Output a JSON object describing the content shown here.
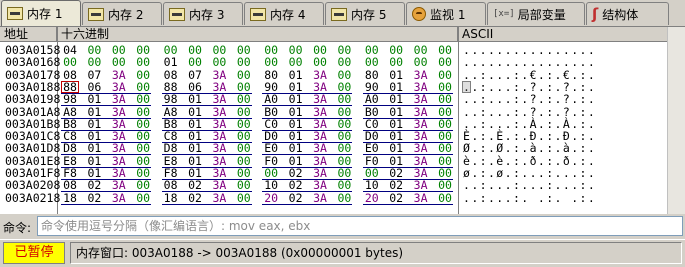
{
  "tabs": [
    {
      "label": "内存 1",
      "icon": "memory-icon",
      "active": true
    },
    {
      "label": "内存 2",
      "icon": "memory-icon",
      "active": false
    },
    {
      "label": "内存 3",
      "icon": "memory-icon",
      "active": false
    },
    {
      "label": "内存 4",
      "icon": "memory-icon",
      "active": false
    },
    {
      "label": "内存 5",
      "icon": "memory-icon",
      "active": false
    },
    {
      "label": "监视 1",
      "icon": "watch-icon",
      "active": false
    },
    {
      "label": "局部变量",
      "icon": "local-vars-icon",
      "icon_text": "[x=]",
      "active": false
    },
    {
      "label": "结构体",
      "icon": "struct-icon",
      "icon_text": "ʃ",
      "active": false
    }
  ],
  "columns": {
    "address": "地址",
    "hex": "十六进制",
    "ascii": "ASCII"
  },
  "colors": {
    "green": "#008000",
    "red": "#c00000",
    "purple": "#800080",
    "black": "#000000",
    "underline": "#000080"
  },
  "rows": [
    {
      "address": "003A0158",
      "bytes": [
        "04",
        "00",
        "00",
        "00",
        "00",
        "00",
        "00",
        "00",
        "00",
        "00",
        "00",
        "00",
        "00",
        "00",
        "00",
        "00"
      ],
      "colors": [
        "k",
        "g",
        "g",
        "g",
        "g",
        "g",
        "g",
        "g",
        "g",
        "g",
        "g",
        "g",
        "g",
        "g",
        "g",
        "g"
      ],
      "ascii": "................"
    },
    {
      "address": "003A0168",
      "bytes": [
        "00",
        "00",
        "00",
        "00",
        "01",
        "00",
        "00",
        "00",
        "00",
        "00",
        "00",
        "00",
        "00",
        "00",
        "00",
        "00"
      ],
      "colors": [
        "g",
        "g",
        "g",
        "g",
        "k",
        "g",
        "g",
        "g",
        "g",
        "g",
        "g",
        "g",
        "g",
        "g",
        "g",
        "g"
      ],
      "ascii": "................"
    },
    {
      "address": "003A0178",
      "bytes": [
        "08",
        "07",
        "3A",
        "00",
        "08",
        "07",
        "3A",
        "00",
        "80",
        "01",
        "3A",
        "00",
        "80",
        "01",
        "3A",
        "00"
      ],
      "colors": [
        "k",
        "k",
        "p",
        "g",
        "k",
        "k",
        "p",
        "g",
        "k",
        "k",
        "p",
        "g",
        "k",
        "k",
        "p",
        "g"
      ],
      "ascii": "..:...:.€.:.€.:."
    },
    {
      "address": "003A0188",
      "bytes": [
        "88",
        "06",
        "3A",
        "00",
        "88",
        "06",
        "3A",
        "00",
        "90",
        "01",
        "3A",
        "00",
        "90",
        "01",
        "3A",
        "00"
      ],
      "colors": [
        "k",
        "k",
        "p",
        "g",
        "k",
        "k",
        "p",
        "g",
        "k",
        "k",
        "p",
        "g",
        "k",
        "k",
        "p",
        "g"
      ],
      "ascii": "..:...:.?.:.?.:."
    },
    {
      "address": "003A0198",
      "bytes": [
        "98",
        "01",
        "3A",
        "00",
        "98",
        "01",
        "3A",
        "00",
        "A0",
        "01",
        "3A",
        "00",
        "A0",
        "01",
        "3A",
        "00"
      ],
      "colors": [
        "k",
        "k",
        "p",
        "g",
        "k",
        "k",
        "p",
        "g",
        "k",
        "k",
        "p",
        "g",
        "k",
        "k",
        "p",
        "g"
      ],
      "ascii": "..:...:.?.:.?.:."
    },
    {
      "address": "003A01A8",
      "bytes": [
        "A8",
        "01",
        "3A",
        "00",
        "A8",
        "01",
        "3A",
        "00",
        "B0",
        "01",
        "3A",
        "00",
        "B0",
        "01",
        "3A",
        "00"
      ],
      "colors": [
        "k",
        "k",
        "p",
        "g",
        "k",
        "k",
        "p",
        "g",
        "k",
        "k",
        "p",
        "g",
        "k",
        "k",
        "p",
        "g"
      ],
      "ascii": "..:...:.?.:.?.:."
    },
    {
      "address": "003A01B8",
      "bytes": [
        "B8",
        "01",
        "3A",
        "00",
        "B8",
        "01",
        "3A",
        "00",
        "C0",
        "01",
        "3A",
        "00",
        "C0",
        "01",
        "3A",
        "00"
      ],
      "colors": [
        "k",
        "k",
        "p",
        "g",
        "k",
        "k",
        "p",
        "g",
        "k",
        "k",
        "p",
        "g",
        "k",
        "k",
        "p",
        "g"
      ],
      "ascii": "..:...:.À.:.À.:."
    },
    {
      "address": "003A01C8",
      "bytes": [
        "C8",
        "01",
        "3A",
        "00",
        "C8",
        "01",
        "3A",
        "00",
        "D0",
        "01",
        "3A",
        "00",
        "D0",
        "01",
        "3A",
        "00"
      ],
      "colors": [
        "k",
        "k",
        "p",
        "g",
        "k",
        "k",
        "p",
        "g",
        "k",
        "k",
        "p",
        "g",
        "k",
        "k",
        "p",
        "g"
      ],
      "ascii": "È.:.È.:.Ð.:.Ð.:."
    },
    {
      "address": "003A01D8",
      "bytes": [
        "D8",
        "01",
        "3A",
        "00",
        "D8",
        "01",
        "3A",
        "00",
        "E0",
        "01",
        "3A",
        "00",
        "E0",
        "01",
        "3A",
        "00"
      ],
      "colors": [
        "k",
        "k",
        "p",
        "g",
        "k",
        "k",
        "p",
        "g",
        "k",
        "k",
        "p",
        "g",
        "k",
        "k",
        "p",
        "g"
      ],
      "ascii": "Ø.:.Ø.:.à.:.à.:."
    },
    {
      "address": "003A01E8",
      "bytes": [
        "E8",
        "01",
        "3A",
        "00",
        "E8",
        "01",
        "3A",
        "00",
        "F0",
        "01",
        "3A",
        "00",
        "F0",
        "01",
        "3A",
        "00"
      ],
      "colors": [
        "k",
        "k",
        "p",
        "g",
        "k",
        "k",
        "p",
        "g",
        "k",
        "k",
        "p",
        "g",
        "k",
        "k",
        "p",
        "g"
      ],
      "ascii": "è.:.è.:.ð.:.ð.:."
    },
    {
      "address": "003A01F8",
      "bytes": [
        "F8",
        "01",
        "3A",
        "00",
        "F8",
        "01",
        "3A",
        "00",
        "00",
        "02",
        "3A",
        "00",
        "00",
        "02",
        "3A",
        "00"
      ],
      "colors": [
        "k",
        "k",
        "p",
        "g",
        "k",
        "k",
        "p",
        "g",
        "g",
        "k",
        "p",
        "g",
        "g",
        "k",
        "p",
        "g"
      ],
      "ascii": "ø.:.ø.:...:...:."
    },
    {
      "address": "003A0208",
      "bytes": [
        "08",
        "02",
        "3A",
        "00",
        "08",
        "02",
        "3A",
        "00",
        "10",
        "02",
        "3A",
        "00",
        "10",
        "02",
        "3A",
        "00"
      ],
      "colors": [
        "k",
        "k",
        "p",
        "g",
        "k",
        "k",
        "p",
        "g",
        "k",
        "k",
        "p",
        "g",
        "k",
        "k",
        "p",
        "g"
      ],
      "ascii": "..:...:...:...:."
    },
    {
      "address": "003A0218",
      "bytes": [
        "18",
        "02",
        "3A",
        "00",
        "18",
        "02",
        "3A",
        "00",
        "20",
        "02",
        "3A",
        "00",
        "20",
        "02",
        "3A",
        "00"
      ],
      "colors": [
        "k",
        "k",
        "p",
        "g",
        "k",
        "k",
        "p",
        "g",
        "p",
        "k",
        "p",
        "g",
        "p",
        "k",
        "p",
        "g"
      ],
      "ascii": "..:...:. .:. .:."
    }
  ],
  "selection": {
    "address": "003A0188",
    "byte_count": 1
  },
  "command": {
    "label": "命令:",
    "placeholder": "命令使用逗号分隔（像汇编语言）: mov eax, ebx"
  },
  "status": {
    "state": "已暂停",
    "text": "内存窗口: 003A0188 -> 003A0188 (0x00000001 bytes)"
  }
}
